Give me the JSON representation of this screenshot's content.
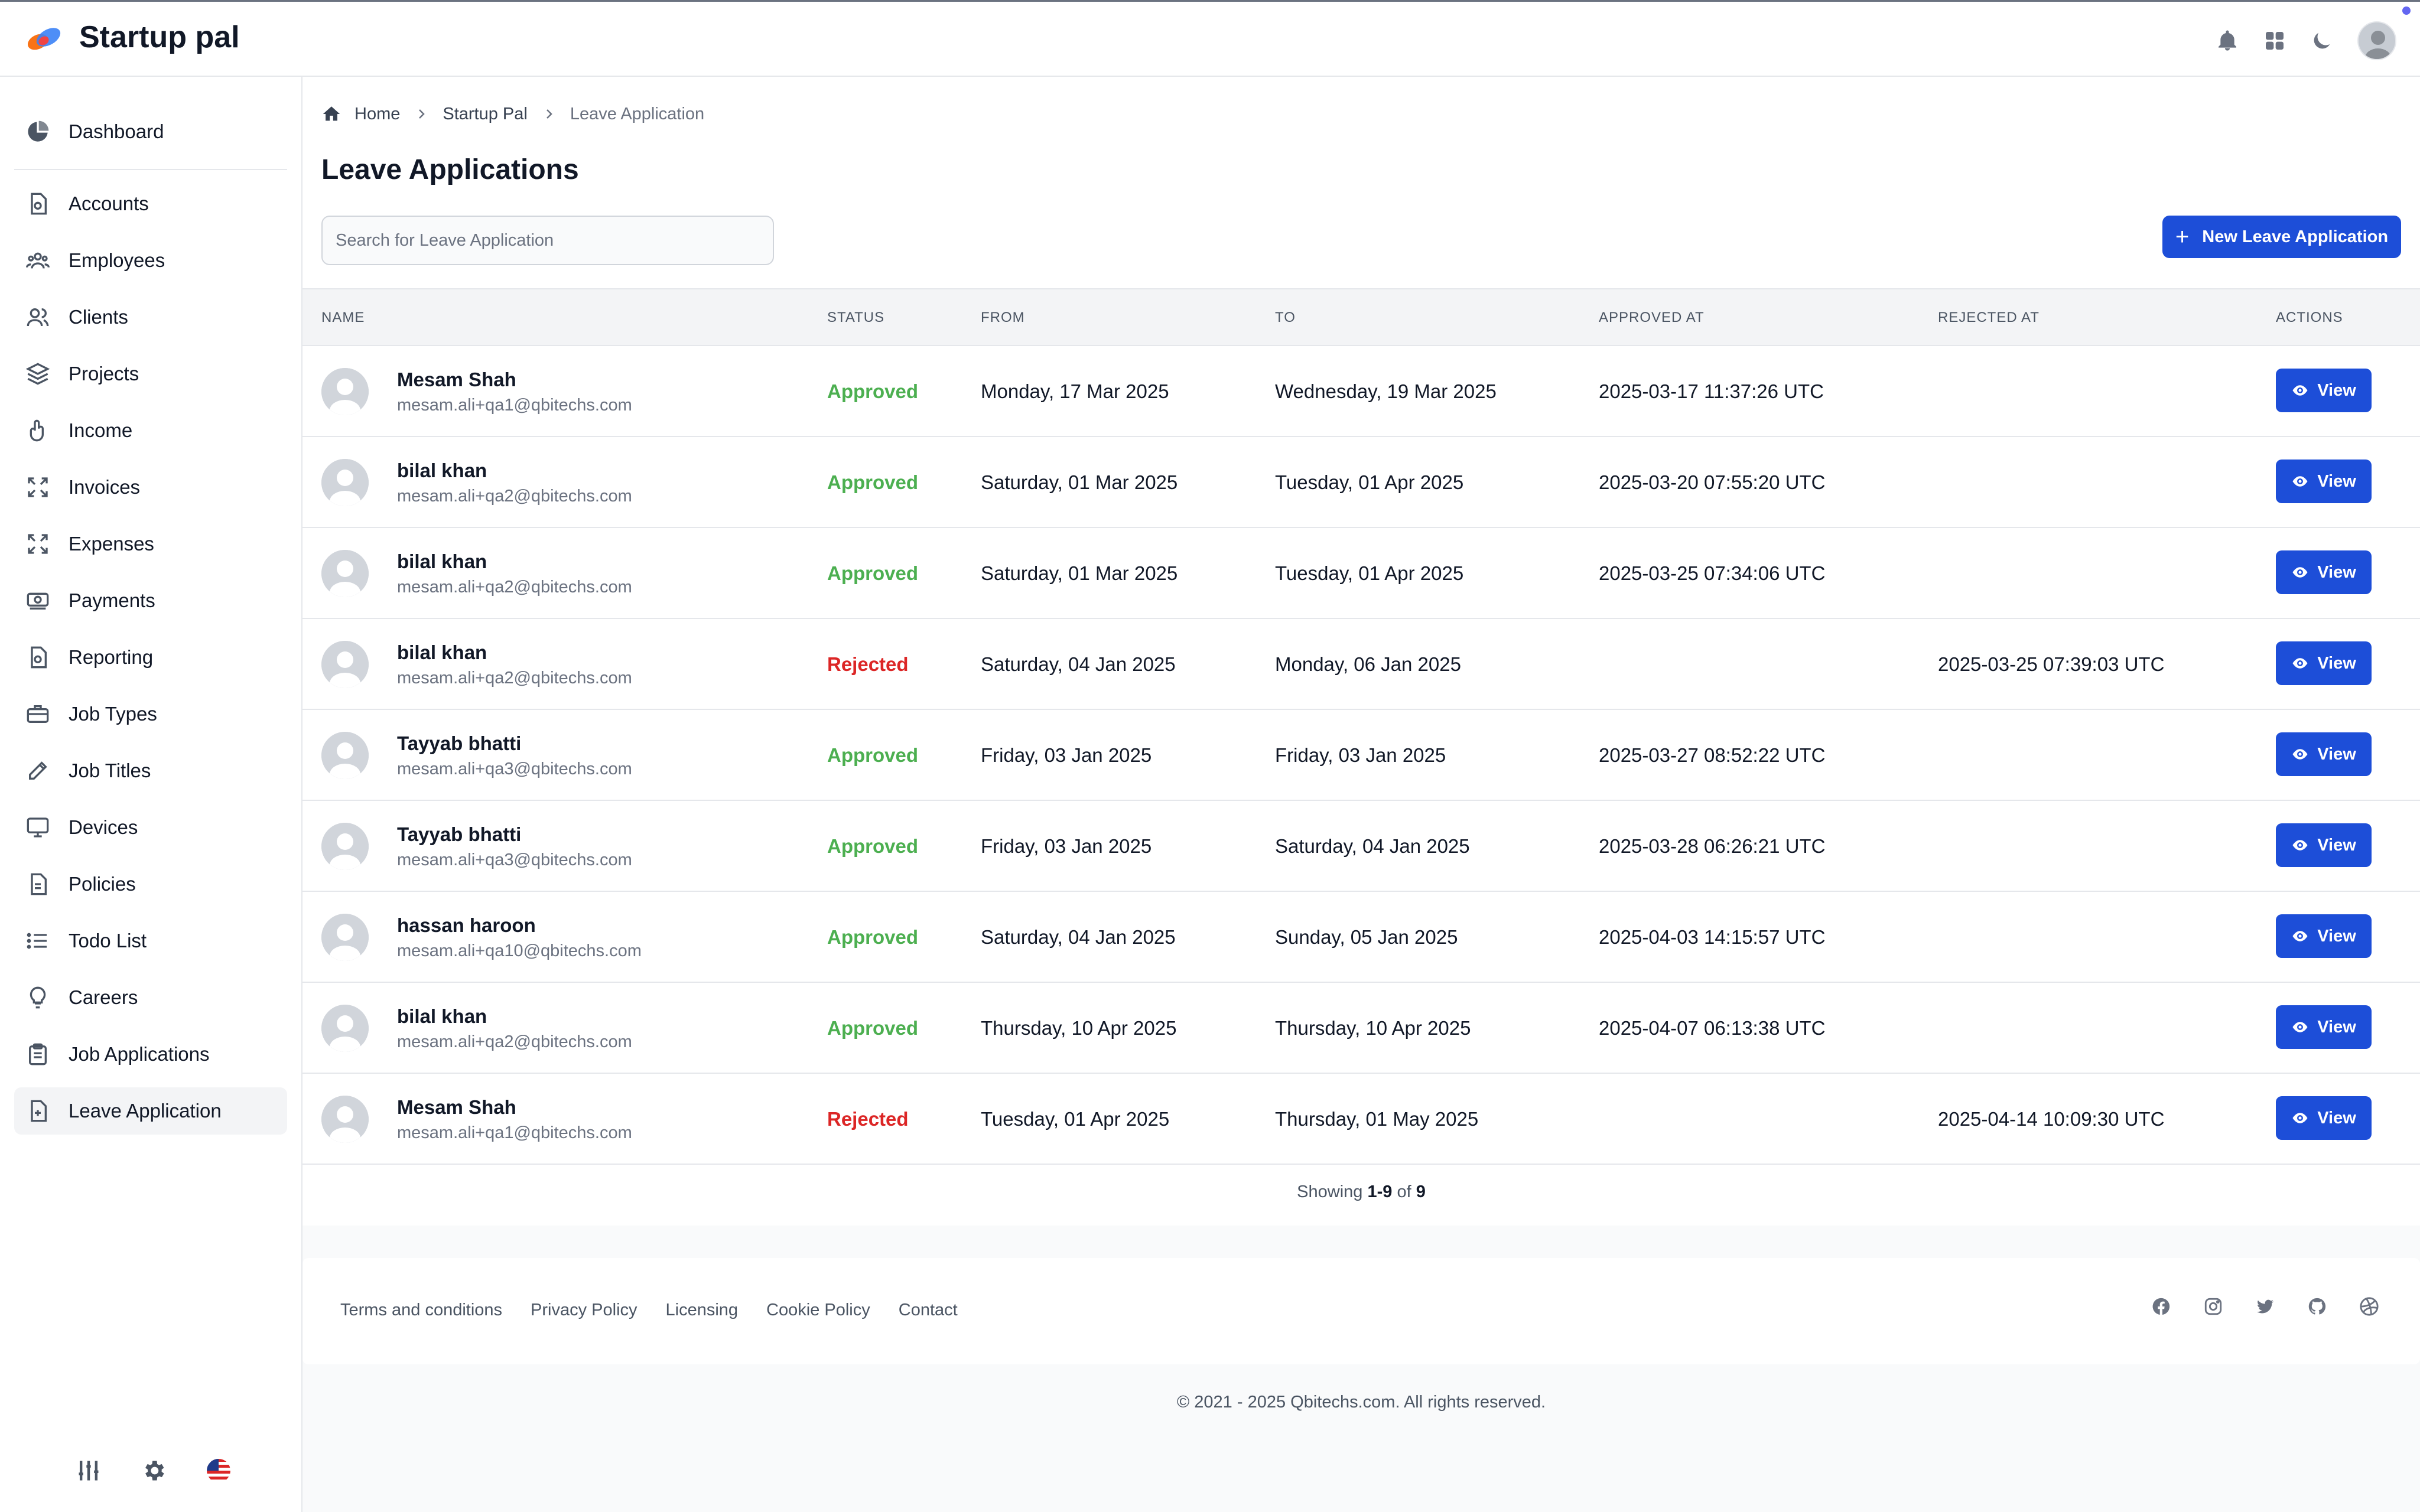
{
  "app": {
    "name": "Startup pal"
  },
  "sidebar": {
    "items": [
      {
        "label": "Dashboard",
        "icon": "pie-chart-icon"
      },
      {
        "label": "Accounts",
        "icon": "document-icon"
      },
      {
        "label": "Employees",
        "icon": "users-icon"
      },
      {
        "label": "Clients",
        "icon": "user-group-icon"
      },
      {
        "label": "Projects",
        "icon": "layers-icon"
      },
      {
        "label": "Income",
        "icon": "hand-coin-icon"
      },
      {
        "label": "Invoices",
        "icon": "expand-icon"
      },
      {
        "label": "Expenses",
        "icon": "expand-icon"
      },
      {
        "label": "Payments",
        "icon": "cash-icon"
      },
      {
        "label": "Reporting",
        "icon": "report-icon"
      },
      {
        "label": "Job Types",
        "icon": "briefcase-icon"
      },
      {
        "label": "Job Titles",
        "icon": "pencil-icon"
      },
      {
        "label": "Devices",
        "icon": "monitor-icon"
      },
      {
        "label": "Policies",
        "icon": "file-icon"
      },
      {
        "label": "Todo List",
        "icon": "list-icon"
      },
      {
        "label": "Careers",
        "icon": "lightbulb-icon"
      },
      {
        "label": "Job Applications",
        "icon": "clipboard-icon"
      },
      {
        "label": "Leave Application",
        "icon": "file-plus-icon"
      }
    ],
    "active_index": 17
  },
  "breadcrumb": {
    "home": "Home",
    "parent": "Startup Pal",
    "current": "Leave Application"
  },
  "page": {
    "title": "Leave Applications",
    "search_placeholder": "Search for Leave Application",
    "new_button": "New Leave Application"
  },
  "table": {
    "headers": {
      "name": "NAME",
      "status": "STATUS",
      "from": "FROM",
      "to": "TO",
      "approved_at": "APPROVED AT",
      "rejected_at": "REJECTED AT",
      "actions": "ACTIONS"
    },
    "view_label": "View",
    "rows": [
      {
        "name": "Mesam Shah",
        "email": "mesam.ali+qa1@qbitechs.com",
        "status": "Approved",
        "from": "Monday, 17 Mar 2025",
        "to": "Wednesday, 19 Mar 2025",
        "approved_at": "2025-03-17 11:37:26 UTC",
        "rejected_at": ""
      },
      {
        "name": "bilal khan",
        "email": "mesam.ali+qa2@qbitechs.com",
        "status": "Approved",
        "from": "Saturday, 01 Mar 2025",
        "to": "Tuesday, 01 Apr 2025",
        "approved_at": "2025-03-20 07:55:20 UTC",
        "rejected_at": ""
      },
      {
        "name": "bilal khan",
        "email": "mesam.ali+qa2@qbitechs.com",
        "status": "Approved",
        "from": "Saturday, 01 Mar 2025",
        "to": "Tuesday, 01 Apr 2025",
        "approved_at": "2025-03-25 07:34:06 UTC",
        "rejected_at": ""
      },
      {
        "name": "bilal khan",
        "email": "mesam.ali+qa2@qbitechs.com",
        "status": "Rejected",
        "from": "Saturday, 04 Jan 2025",
        "to": "Monday, 06 Jan 2025",
        "approved_at": "",
        "rejected_at": "2025-03-25 07:39:03 UTC"
      },
      {
        "name": "Tayyab bhatti",
        "email": "mesam.ali+qa3@qbitechs.com",
        "status": "Approved",
        "from": "Friday, 03 Jan 2025",
        "to": "Friday, 03 Jan 2025",
        "approved_at": "2025-03-27 08:52:22 UTC",
        "rejected_at": ""
      },
      {
        "name": "Tayyab bhatti",
        "email": "mesam.ali+qa3@qbitechs.com",
        "status": "Approved",
        "from": "Friday, 03 Jan 2025",
        "to": "Saturday, 04 Jan 2025",
        "approved_at": "2025-03-28 06:26:21 UTC",
        "rejected_at": ""
      },
      {
        "name": "hassan haroon",
        "email": "mesam.ali+qa10@qbitechs.com",
        "status": "Approved",
        "from": "Saturday, 04 Jan 2025",
        "to": "Sunday, 05 Jan 2025",
        "approved_at": "2025-04-03 14:15:57 UTC",
        "rejected_at": ""
      },
      {
        "name": "bilal khan",
        "email": "mesam.ali+qa2@qbitechs.com",
        "status": "Approved",
        "from": "Thursday, 10 Apr 2025",
        "to": "Thursday, 10 Apr 2025",
        "approved_at": "2025-04-07 06:13:38 UTC",
        "rejected_at": ""
      },
      {
        "name": "Mesam Shah",
        "email": "mesam.ali+qa1@qbitechs.com",
        "status": "Rejected",
        "from": "Tuesday, 01 Apr 2025",
        "to": "Thursday, 01 May 2025",
        "approved_at": "",
        "rejected_at": "2025-04-14 10:09:30 UTC"
      }
    ]
  },
  "pagination": {
    "prefix": "Showing",
    "range": "1-9",
    "of": "of",
    "total": "9"
  },
  "footer": {
    "links": [
      "Terms and conditions",
      "Privacy Policy",
      "Licensing",
      "Cookie Policy",
      "Contact"
    ],
    "social": [
      "facebook-icon",
      "instagram-icon",
      "twitter-icon",
      "github-icon",
      "dribbble-icon"
    ],
    "copyright": "© 2021 - 2025 Qbitechs.com. All rights reserved."
  },
  "colors": {
    "primary": "#1d4ed8",
    "approved": "#4caf50",
    "rejected": "#dc2626"
  }
}
